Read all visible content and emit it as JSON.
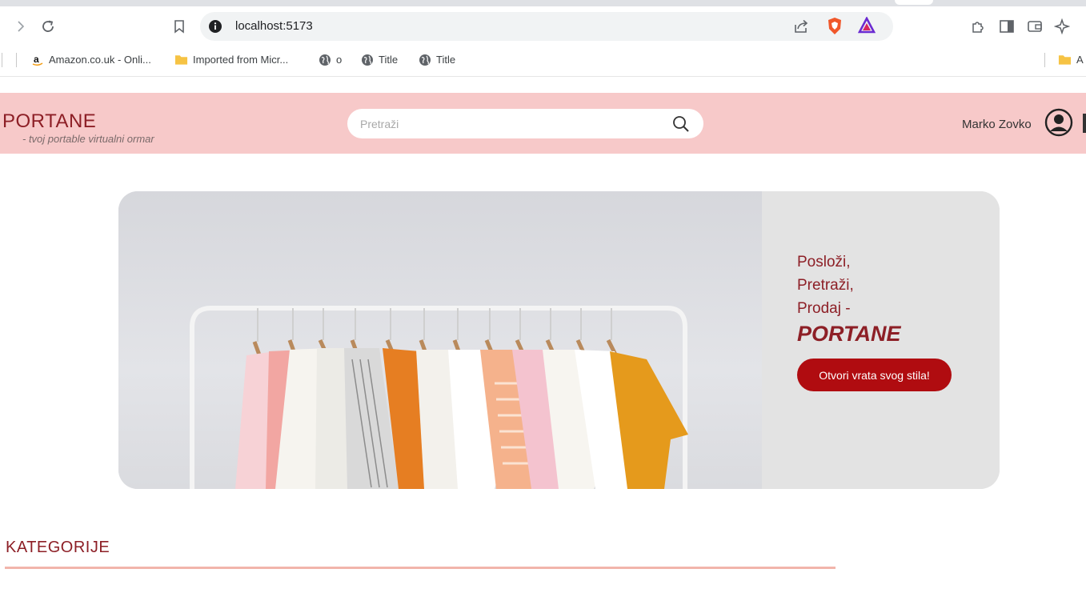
{
  "browser": {
    "url": "localhost:5173",
    "bookmarks": [
      {
        "label": "Amazon.co.uk - Onli...",
        "icon": "amazon-icon"
      },
      {
        "label": "Imported from Micr...",
        "icon": "folder-icon"
      },
      {
        "label": "o",
        "icon": "globe-icon"
      },
      {
        "label": "Title",
        "icon": "globe-icon"
      },
      {
        "label": "Title",
        "icon": "globe-icon"
      },
      {
        "label": "A",
        "icon": "folder-icon"
      }
    ]
  },
  "header": {
    "logo": "PORTANE",
    "tagline": "- tvoj portable virtualni ormar",
    "search_placeholder": "Pretraži",
    "user_name": "Marko Zovko",
    "colors": {
      "background": "#f7c9c9",
      "brand": "#8d1f26"
    }
  },
  "hero": {
    "slogan_lines": [
      "Posloži,",
      "Pretraži,",
      "Prodaj -"
    ],
    "brand": "PORTANE",
    "cta_label": "Otvori vrata svog stila!",
    "colors": {
      "cta": "#b00c10",
      "text": "#8d1f26"
    }
  },
  "categories": {
    "title": "KATEGORIJE",
    "accent": "#f2b5ab"
  }
}
